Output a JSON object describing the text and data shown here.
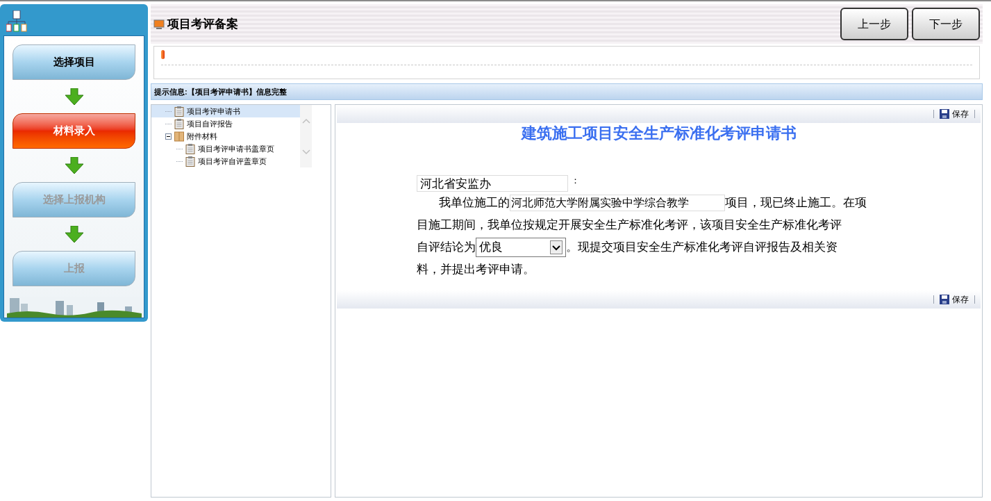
{
  "steps": [
    {
      "label": "选择项目",
      "selected": false,
      "disabled": false
    },
    {
      "label": "材料录入",
      "selected": true,
      "disabled": false
    },
    {
      "label": "选择上报机构",
      "selected": false,
      "disabled": true
    },
    {
      "label": "上报",
      "selected": false,
      "disabled": true
    }
  ],
  "header": {
    "title": "项目考评备案",
    "buttons": [
      "上一步",
      "下一步"
    ]
  },
  "info_bar": "提示信息:【项目考评申请书】信息完整",
  "tree": [
    {
      "label": "项目考评申请书",
      "kind": "doc",
      "selected": true
    },
    {
      "label": "项目自评报告",
      "kind": "doc",
      "selected": false
    },
    {
      "label": "附件材料",
      "kind": "folder",
      "selected": false,
      "expanded": true,
      "children": [
        {
          "label": "项目考评申请书盖章页",
          "kind": "doc",
          "selected": false
        },
        {
          "label": "项目考评自评盖章页",
          "kind": "doc",
          "selected": false
        }
      ]
    }
  ],
  "document": {
    "save_label_top": "保存",
    "title": "建筑施工项目安全生产标准化考评申请书",
    "recipient": "河北省安监办",
    "recipient_suffix": "：",
    "lines": [
      [
        {
          "kind": "text",
          "text": "我单位施工的"
        },
        {
          "kind": "field",
          "value": "河北师范大学附属实验中学综合教学"
        },
        {
          "kind": "text",
          "text": "项目，现已终止施工。在项"
        }
      ],
      [
        {
          "kind": "text",
          "text": "目施工期间，我单位按规定开展安全生产标准化考评，该项目安全生产标准化考评"
        }
      ],
      [
        {
          "kind": "text",
          "text": "自评结论为"
        },
        {
          "kind": "select",
          "value": "优良"
        },
        {
          "kind": "text",
          "text": "。现提交项目安全生产标准化考评自评报告及相关资"
        }
      ],
      [
        {
          "kind": "text",
          "text": "料，并提出考评申请。"
        }
      ]
    ],
    "save_label_bottom": "保存"
  }
}
